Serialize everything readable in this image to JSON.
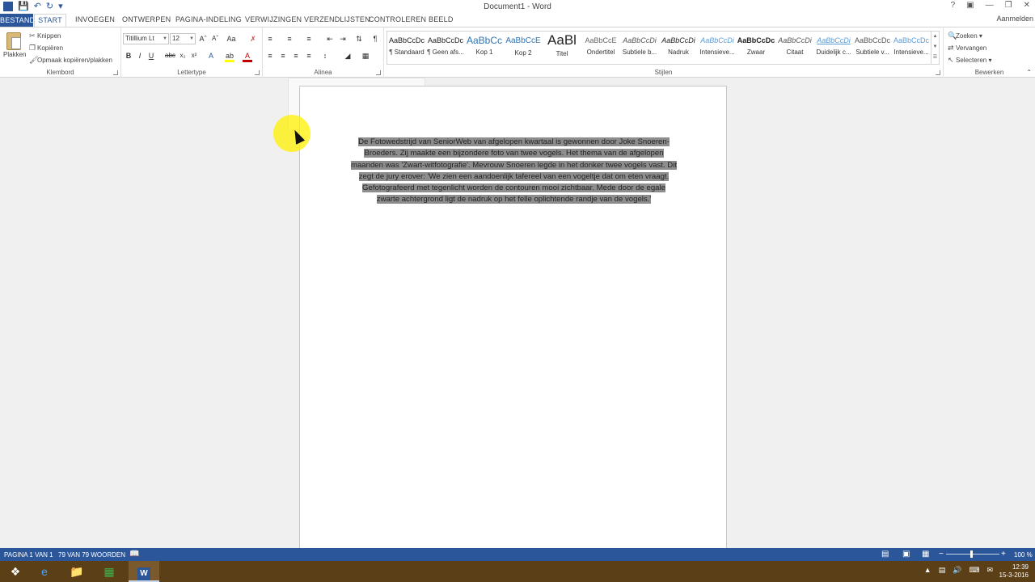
{
  "app": {
    "window_title": "Document1 - Word",
    "signin": "Aanmelden"
  },
  "tabs": {
    "file": "BESTAND",
    "start": "START",
    "insert": "INVOEGEN",
    "design": "ONTWERPEN",
    "layout": "PAGINA-INDELING",
    "references": "VERWIJZINGEN",
    "mailings": "VERZENDLIJSTEN",
    "review": "CONTROLEREN",
    "view": "BEELD"
  },
  "clipboard": {
    "paste": "Plakken",
    "cut": "Knippen",
    "copy": "Kopiëren",
    "format_painter": "Opmaak kopiëren/plakken",
    "label": "Klembord"
  },
  "font": {
    "name": "Titillium Lt",
    "size": "12",
    "label": "Lettertype"
  },
  "paragraph": {
    "label": "Alinea"
  },
  "styles": {
    "label": "Stijlen",
    "items": [
      {
        "preview": "AaBbCcDc",
        "name": "¶ Standaard"
      },
      {
        "preview": "AaBbCcDc",
        "name": "¶ Geen afs..."
      },
      {
        "preview": "AaBbCc",
        "name": "Kop 1"
      },
      {
        "preview": "AaBbCcE",
        "name": "Kop 2"
      },
      {
        "preview": "AaBl",
        "name": "Titel"
      },
      {
        "preview": "AaBbCcE",
        "name": "Ondertitel"
      },
      {
        "preview": "AaBbCcDi",
        "name": "Subtiele b..."
      },
      {
        "preview": "AaBbCcDi",
        "name": "Nadruk"
      },
      {
        "preview": "AaBbCcDi",
        "name": "Intensieve..."
      },
      {
        "preview": "AaBbCcDc",
        "name": "Zwaar"
      },
      {
        "preview": "AaBbCcDi",
        "name": "Citaat"
      },
      {
        "preview": "AaBbCcDi",
        "name": "Duidelijk c..."
      },
      {
        "preview": "AaBbCcDc",
        "name": "Subtiele v..."
      },
      {
        "preview": "AaBbCcDc",
        "name": "Intensieve..."
      }
    ]
  },
  "editing": {
    "find": "Zoeken",
    "replace": "Vervangen",
    "select": "Selecteren",
    "label": "Bewerken"
  },
  "document": {
    "paragraph": "De Fotowedstrijd van SeniorWeb van afgelopen kwartaal is gewonnen door Joke Snoeren-Broeders. Zij maakte een bijzondere foto van twee vogels. Het thema van de afgelopen maanden was 'Zwart-witfotografie'. Mevrouw Snoeren legde in het donker twee vogels vast. Dit zegt de jury erover: 'We zien een aandoenlijk tafereel van een vogeltje dat om eten vraagt. Gefotografeerd met tegenlicht worden de contouren mooi zichtbaar. Mede door de egale zwarte achtergrond ligt de nadruk op het felle oplichtende randje van de vogels.'"
  },
  "status": {
    "page": "PAGINA 1 VAN 1",
    "words": "79 VAN 79 WOORDEN",
    "zoom": "100 %"
  },
  "taskbar": {
    "time": "12:39",
    "date": "15-3-2016"
  }
}
